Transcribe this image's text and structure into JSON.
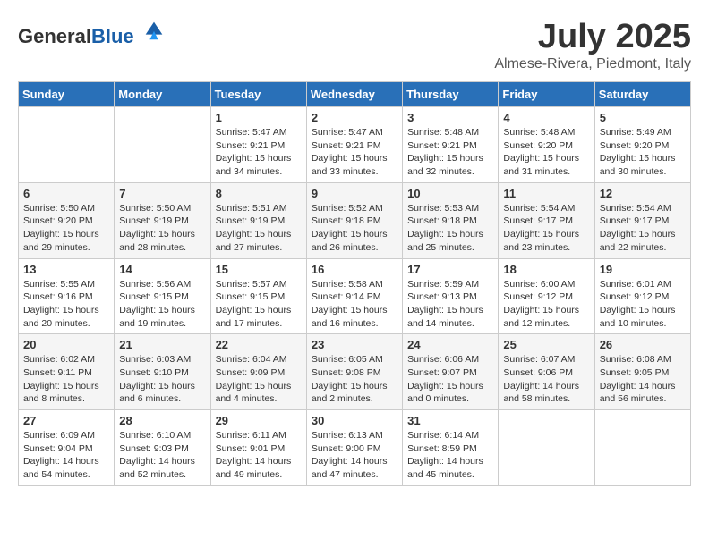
{
  "header": {
    "logo_general": "General",
    "logo_blue": "Blue",
    "month_year": "July 2025",
    "location": "Almese-Rivera, Piedmont, Italy"
  },
  "weekdays": [
    "Sunday",
    "Monday",
    "Tuesday",
    "Wednesday",
    "Thursday",
    "Friday",
    "Saturday"
  ],
  "weeks": [
    [
      {
        "day": "",
        "sunrise": "",
        "sunset": "",
        "daylight": ""
      },
      {
        "day": "",
        "sunrise": "",
        "sunset": "",
        "daylight": ""
      },
      {
        "day": "1",
        "sunrise": "Sunrise: 5:47 AM",
        "sunset": "Sunset: 9:21 PM",
        "daylight": "Daylight: 15 hours and 34 minutes."
      },
      {
        "day": "2",
        "sunrise": "Sunrise: 5:47 AM",
        "sunset": "Sunset: 9:21 PM",
        "daylight": "Daylight: 15 hours and 33 minutes."
      },
      {
        "day": "3",
        "sunrise": "Sunrise: 5:48 AM",
        "sunset": "Sunset: 9:21 PM",
        "daylight": "Daylight: 15 hours and 32 minutes."
      },
      {
        "day": "4",
        "sunrise": "Sunrise: 5:48 AM",
        "sunset": "Sunset: 9:20 PM",
        "daylight": "Daylight: 15 hours and 31 minutes."
      },
      {
        "day": "5",
        "sunrise": "Sunrise: 5:49 AM",
        "sunset": "Sunset: 9:20 PM",
        "daylight": "Daylight: 15 hours and 30 minutes."
      }
    ],
    [
      {
        "day": "6",
        "sunrise": "Sunrise: 5:50 AM",
        "sunset": "Sunset: 9:20 PM",
        "daylight": "Daylight: 15 hours and 29 minutes."
      },
      {
        "day": "7",
        "sunrise": "Sunrise: 5:50 AM",
        "sunset": "Sunset: 9:19 PM",
        "daylight": "Daylight: 15 hours and 28 minutes."
      },
      {
        "day": "8",
        "sunrise": "Sunrise: 5:51 AM",
        "sunset": "Sunset: 9:19 PM",
        "daylight": "Daylight: 15 hours and 27 minutes."
      },
      {
        "day": "9",
        "sunrise": "Sunrise: 5:52 AM",
        "sunset": "Sunset: 9:18 PM",
        "daylight": "Daylight: 15 hours and 26 minutes."
      },
      {
        "day": "10",
        "sunrise": "Sunrise: 5:53 AM",
        "sunset": "Sunset: 9:18 PM",
        "daylight": "Daylight: 15 hours and 25 minutes."
      },
      {
        "day": "11",
        "sunrise": "Sunrise: 5:54 AM",
        "sunset": "Sunset: 9:17 PM",
        "daylight": "Daylight: 15 hours and 23 minutes."
      },
      {
        "day": "12",
        "sunrise": "Sunrise: 5:54 AM",
        "sunset": "Sunset: 9:17 PM",
        "daylight": "Daylight: 15 hours and 22 minutes."
      }
    ],
    [
      {
        "day": "13",
        "sunrise": "Sunrise: 5:55 AM",
        "sunset": "Sunset: 9:16 PM",
        "daylight": "Daylight: 15 hours and 20 minutes."
      },
      {
        "day": "14",
        "sunrise": "Sunrise: 5:56 AM",
        "sunset": "Sunset: 9:15 PM",
        "daylight": "Daylight: 15 hours and 19 minutes."
      },
      {
        "day": "15",
        "sunrise": "Sunrise: 5:57 AM",
        "sunset": "Sunset: 9:15 PM",
        "daylight": "Daylight: 15 hours and 17 minutes."
      },
      {
        "day": "16",
        "sunrise": "Sunrise: 5:58 AM",
        "sunset": "Sunset: 9:14 PM",
        "daylight": "Daylight: 15 hours and 16 minutes."
      },
      {
        "day": "17",
        "sunrise": "Sunrise: 5:59 AM",
        "sunset": "Sunset: 9:13 PM",
        "daylight": "Daylight: 15 hours and 14 minutes."
      },
      {
        "day": "18",
        "sunrise": "Sunrise: 6:00 AM",
        "sunset": "Sunset: 9:12 PM",
        "daylight": "Daylight: 15 hours and 12 minutes."
      },
      {
        "day": "19",
        "sunrise": "Sunrise: 6:01 AM",
        "sunset": "Sunset: 9:12 PM",
        "daylight": "Daylight: 15 hours and 10 minutes."
      }
    ],
    [
      {
        "day": "20",
        "sunrise": "Sunrise: 6:02 AM",
        "sunset": "Sunset: 9:11 PM",
        "daylight": "Daylight: 15 hours and 8 minutes."
      },
      {
        "day": "21",
        "sunrise": "Sunrise: 6:03 AM",
        "sunset": "Sunset: 9:10 PM",
        "daylight": "Daylight: 15 hours and 6 minutes."
      },
      {
        "day": "22",
        "sunrise": "Sunrise: 6:04 AM",
        "sunset": "Sunset: 9:09 PM",
        "daylight": "Daylight: 15 hours and 4 minutes."
      },
      {
        "day": "23",
        "sunrise": "Sunrise: 6:05 AM",
        "sunset": "Sunset: 9:08 PM",
        "daylight": "Daylight: 15 hours and 2 minutes."
      },
      {
        "day": "24",
        "sunrise": "Sunrise: 6:06 AM",
        "sunset": "Sunset: 9:07 PM",
        "daylight": "Daylight: 15 hours and 0 minutes."
      },
      {
        "day": "25",
        "sunrise": "Sunrise: 6:07 AM",
        "sunset": "Sunset: 9:06 PM",
        "daylight": "Daylight: 14 hours and 58 minutes."
      },
      {
        "day": "26",
        "sunrise": "Sunrise: 6:08 AM",
        "sunset": "Sunset: 9:05 PM",
        "daylight": "Daylight: 14 hours and 56 minutes."
      }
    ],
    [
      {
        "day": "27",
        "sunrise": "Sunrise: 6:09 AM",
        "sunset": "Sunset: 9:04 PM",
        "daylight": "Daylight: 14 hours and 54 minutes."
      },
      {
        "day": "28",
        "sunrise": "Sunrise: 6:10 AM",
        "sunset": "Sunset: 9:03 PM",
        "daylight": "Daylight: 14 hours and 52 minutes."
      },
      {
        "day": "29",
        "sunrise": "Sunrise: 6:11 AM",
        "sunset": "Sunset: 9:01 PM",
        "daylight": "Daylight: 14 hours and 49 minutes."
      },
      {
        "day": "30",
        "sunrise": "Sunrise: 6:13 AM",
        "sunset": "Sunset: 9:00 PM",
        "daylight": "Daylight: 14 hours and 47 minutes."
      },
      {
        "day": "31",
        "sunrise": "Sunrise: 6:14 AM",
        "sunset": "Sunset: 8:59 PM",
        "daylight": "Daylight: 14 hours and 45 minutes."
      },
      {
        "day": "",
        "sunrise": "",
        "sunset": "",
        "daylight": ""
      },
      {
        "day": "",
        "sunrise": "",
        "sunset": "",
        "daylight": ""
      }
    ]
  ]
}
